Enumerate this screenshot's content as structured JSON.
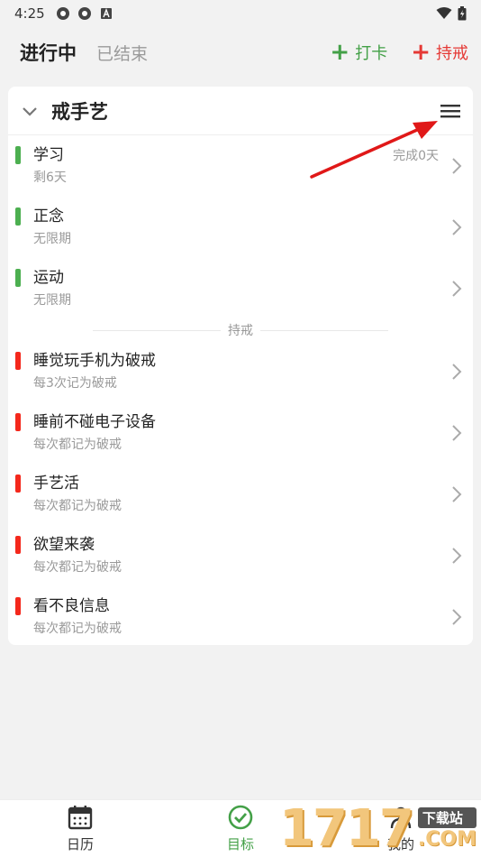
{
  "status_bar": {
    "time": "4:25"
  },
  "header": {
    "tab_active": "进行中",
    "tab_inactive": "已结束",
    "checkin_label": "打卡",
    "abstain_label": "持戒",
    "plus_symbol": "+",
    "colors": {
      "green": "#43a047",
      "red": "#e53935"
    }
  },
  "card": {
    "title": "戒手艺",
    "checkin_items": [
      {
        "title": "学习",
        "sub": "剩6天",
        "extra": "完成0天"
      },
      {
        "title": "正念",
        "sub": "无限期",
        "extra": ""
      },
      {
        "title": "运动",
        "sub": "无限期",
        "extra": ""
      }
    ],
    "divider_label": "持戒",
    "abstain_items": [
      {
        "title": "睡觉玩手机为破戒",
        "sub": "每3次记为破戒"
      },
      {
        "title": "睡前不碰电子设备",
        "sub": "每次都记为破戒"
      },
      {
        "title": "手艺活",
        "sub": "每次都记为破戒"
      },
      {
        "title": "欲望来袭",
        "sub": "每次都记为破戒"
      },
      {
        "title": "看不良信息",
        "sub": "每次都记为破戒"
      }
    ]
  },
  "bottom_nav": {
    "calendar": "日历",
    "goals": "目标",
    "mine": "我的"
  },
  "watermark": {
    "number": "1717",
    "badge": "下载站",
    "suffix": ".COM"
  }
}
